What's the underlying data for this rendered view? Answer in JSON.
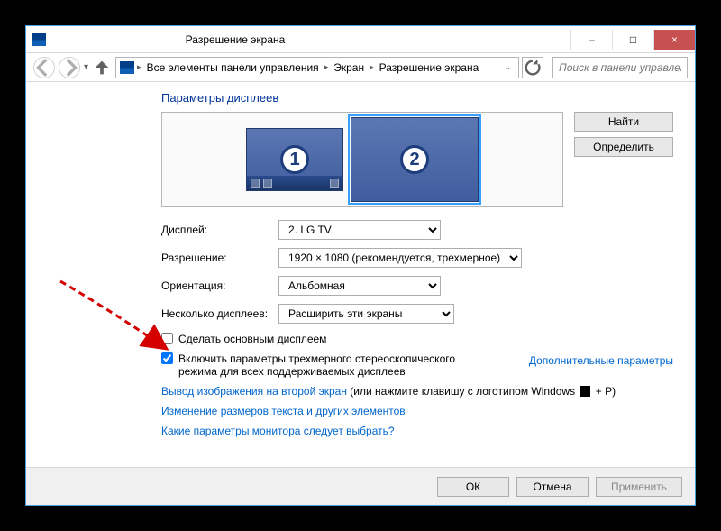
{
  "window": {
    "title": "Разрешение экрана",
    "minimize": "–",
    "maximize": "□",
    "close": "×"
  },
  "nav": {
    "crumb1": "Все элементы панели управления",
    "crumb2": "Экран",
    "crumb3": "Разрешение экрана",
    "search_placeholder": "Поиск в панели управления"
  },
  "heading": "Параметры дисплеев",
  "buttons": {
    "find": "Найти",
    "identify": "Определить",
    "ok": "ОК",
    "cancel": "Отмена",
    "apply": "Применить"
  },
  "labels": {
    "display": "Дисплей:",
    "resolution": "Разрешение:",
    "orientation": "Ориентация:",
    "multiple": "Несколько дисплеев:"
  },
  "values": {
    "display": "2. LG TV",
    "resolution": "1920 × 1080 (рекомендуется, трехмерное)",
    "orientation": "Альбомная",
    "multiple": "Расширить эти экраны"
  },
  "checkboxes": {
    "primary": "Сделать основным дисплеем",
    "stereo": "Включить параметры трехмерного стереоскопического режима для всех поддерживаемых дисплеев"
  },
  "links": {
    "advanced": "Дополнительные параметры",
    "secondscreen_lead": "Вывод изображения на второй экран",
    "secondscreen_tail": " (или нажмите клавишу с логотипом Windows ",
    "secondscreen_tail2": " + P)",
    "textsize": "Изменение размеров текста и других элементов",
    "monitorpick": "Какие параметры монитора следует выбрать?"
  },
  "monitors": {
    "m1": "1",
    "m2": "2"
  }
}
